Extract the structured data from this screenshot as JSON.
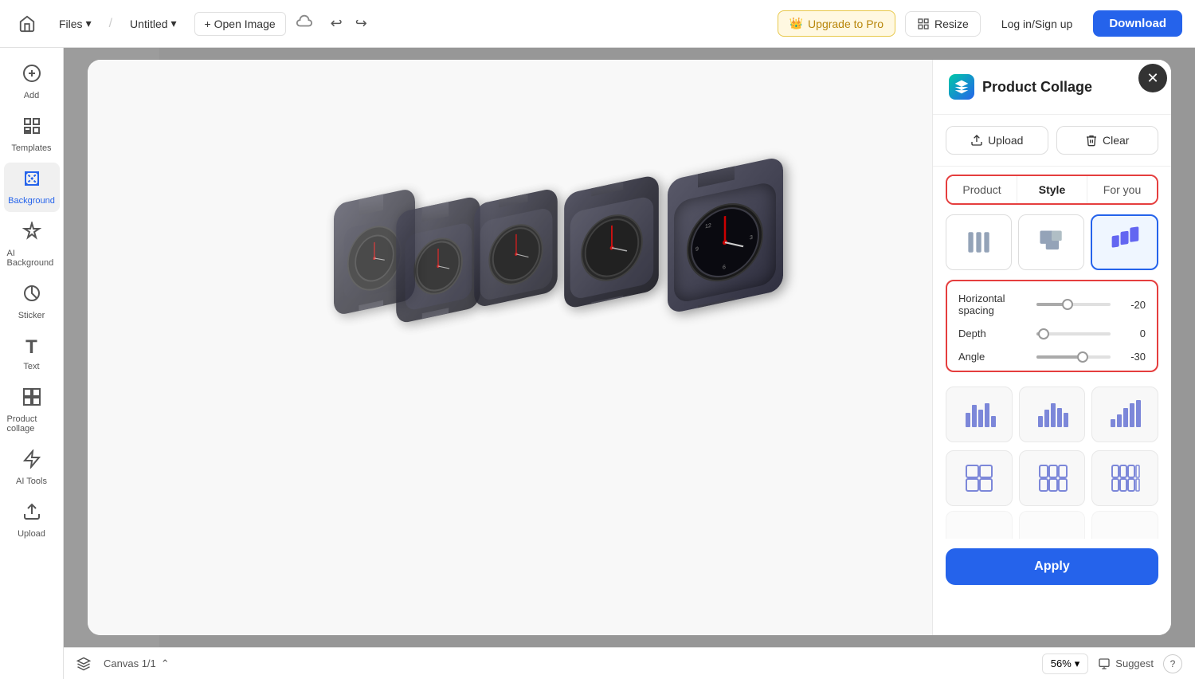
{
  "topbar": {
    "home_icon": "⌂",
    "files_label": "Files",
    "files_chevron": "▾",
    "title": "Untitled",
    "title_chevron": "▾",
    "open_image": "+ Open Image",
    "undo_icon": "↩",
    "redo_icon": "↪",
    "upgrade_label": "Upgrade to Pro",
    "resize_label": "Resize",
    "login_label": "Log in/Sign up",
    "download_label": "Download"
  },
  "sidebar": {
    "items": [
      {
        "id": "add",
        "icon": "＋",
        "label": "Add"
      },
      {
        "id": "templates",
        "icon": "▦",
        "label": "Templates"
      },
      {
        "id": "background",
        "icon": "⬚",
        "label": "Background",
        "active": true
      },
      {
        "id": "ai-background",
        "icon": "✦",
        "label": "AI Background"
      },
      {
        "id": "sticker",
        "icon": "◎",
        "label": "Sticker"
      },
      {
        "id": "text",
        "icon": "T",
        "label": "Text"
      },
      {
        "id": "product-collage",
        "icon": "⊞",
        "label": "Product collage"
      },
      {
        "id": "ai-tools",
        "icon": "⚡",
        "label": "AI Tools"
      },
      {
        "id": "upload",
        "icon": "↑",
        "label": "Upload"
      }
    ]
  },
  "modal": {
    "title": "Product Collage",
    "upload_label": "Upload",
    "clear_label": "Clear",
    "tabs": [
      {
        "id": "product",
        "label": "Product"
      },
      {
        "id": "style",
        "label": "Style",
        "active": true
      },
      {
        "id": "for-you",
        "label": "For you"
      }
    ],
    "sliders": {
      "horizontal_spacing": {
        "label": "Horizontal spacing",
        "value": -20,
        "percent": 42
      },
      "depth": {
        "label": "Depth",
        "value": 0,
        "percent": 10
      },
      "angle": {
        "label": "Angle",
        "value": -30,
        "percent": 62
      }
    },
    "apply_label": "Apply",
    "close_icon": "✕"
  },
  "bottombar": {
    "layers_icon": "◧",
    "canvas_label": "Canvas 1/1",
    "expand_icon": "⌃",
    "zoom_label": "56%",
    "suggest_label": "Suggest",
    "help_label": "?"
  }
}
